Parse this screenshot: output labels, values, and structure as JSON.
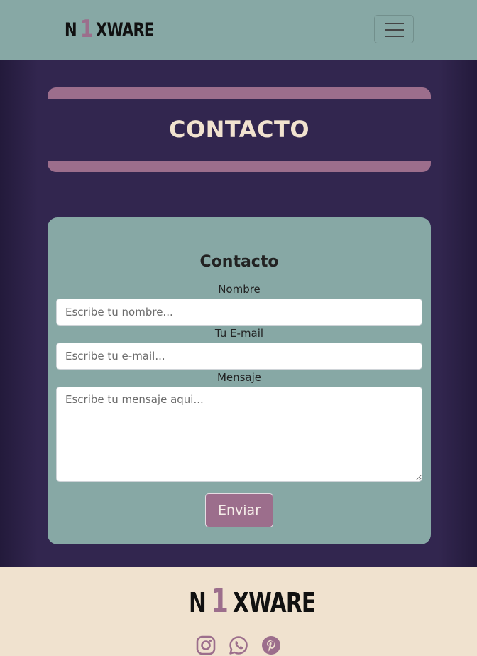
{
  "brand": {
    "logo_part1": "N",
    "logo_number": "1",
    "logo_part2": "XWARE"
  },
  "navbar": {
    "menu_icon": "hamburger-menu-icon"
  },
  "header": {
    "title": "CONTACTO"
  },
  "form": {
    "title": "Contacto",
    "name_label": "Nombre",
    "name_placeholder": "Escribe tu nombre...",
    "email_label": "Tu E-mail",
    "email_placeholder": "Escribe tu e-mail...",
    "message_label": "Mensaje",
    "message_placeholder": "Escribe tu mensaje aqui...",
    "submit_label": "Enviar"
  },
  "footer": {
    "social": [
      "instagram-icon",
      "whatsapp-icon",
      "pinterest-icon"
    ]
  },
  "colors": {
    "nav_bg": "#87a8a5",
    "main_bg": "#32264f",
    "accent": "#9c6e8c",
    "title_text": "#f1e2cf",
    "footer_bg": "#f0e2cf"
  }
}
